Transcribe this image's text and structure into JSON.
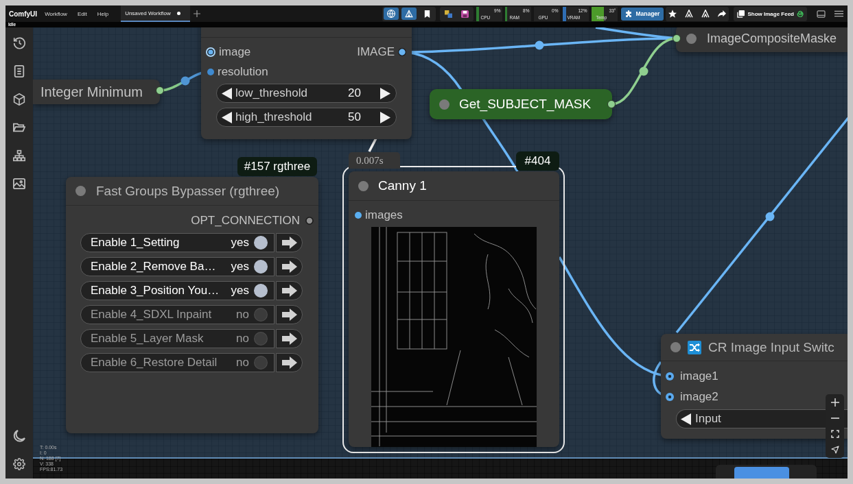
{
  "menu_bar": {
    "app_name": "ComfyUI",
    "menus": [
      "Workflow",
      "Edit",
      "Help"
    ]
  },
  "tabs": [
    {
      "label": "Unsaved Workflow",
      "selected": true,
      "unsaved": true
    }
  ],
  "toolbar": {
    "toggles": [
      {
        "kind": "translate",
        "on": true
      },
      {
        "kind": "shape",
        "on": true
      },
      {
        "kind": "bookmark",
        "on": false
      }
    ],
    "monitors": [
      {
        "label": "CPU",
        "reading": "9%",
        "level": 0.09,
        "color": "#2e7d32"
      },
      {
        "label": "RAM",
        "reading": "8%",
        "level": 0.08,
        "color": "#2e7d32"
      },
      {
        "label": "GPU",
        "reading": "0%"
      },
      {
        "label": "VRAM",
        "reading": "12%",
        "level": 0.12,
        "color": "#2f6db3"
      },
      {
        "label": "Temp",
        "reading": "33°",
        "level": 0.45,
        "color": "#4c9a2a"
      }
    ],
    "manager_button": {
      "label": "Manager"
    },
    "image_feed_button": {
      "label": "Show Image Feed"
    }
  },
  "status": {
    "label": "Idle"
  },
  "canvas": {
    "edge_node": {
      "inputs": [
        {
          "label": "image",
          "highlighted": true
        },
        {
          "label": "resolution",
          "highlighted": false
        }
      ],
      "outputs": [
        {
          "label": "IMAGE"
        }
      ],
      "widgets": [
        {
          "label": "low_threshold",
          "value": "20"
        },
        {
          "label": "high_threshold",
          "value": "50"
        }
      ]
    },
    "collapsed_nodes": [
      {
        "title": "Integer Minimum",
        "color": "#353535"
      },
      {
        "title": "Get_SUBJECT_MASK",
        "color": "#2b6426"
      },
      {
        "title": "ImageCompositeMaske",
        "color": "#353535"
      }
    ],
    "bypasser_node": {
      "badge": "#157 rgthree",
      "title": "Fast Groups Bypasser (rgthree)",
      "output": "OPT_CONNECTION",
      "groups": [
        {
          "label": "Enable 1_Setting",
          "value": "yes",
          "on": true
        },
        {
          "label": "Enable 2_Remove Ba…",
          "value": "yes",
          "on": true
        },
        {
          "label": "Enable 3_Position You…",
          "value": "yes",
          "on": true
        },
        {
          "label": "Enable 4_SDXL Inpaint",
          "value": "no",
          "on": false
        },
        {
          "label": "Enable 5_Layer Mask",
          "value": "no",
          "on": false
        },
        {
          "label": "Enable 6_Restore Detail",
          "value": "no",
          "on": false
        }
      ]
    },
    "canny_node": {
      "timing": "0.007s",
      "badge": "#404",
      "title": "Canny 1",
      "selected": true,
      "inputs": [
        {
          "label": "images"
        }
      ]
    },
    "switch_node": {
      "title": "CR Image Input Switc",
      "inputs": [
        {
          "label": "image1"
        },
        {
          "label": "image2"
        }
      ],
      "widget": {
        "label": "Input"
      }
    },
    "stats": [
      "T: 0.00s",
      "I: 0",
      "N: 188 [7]",
      "V: 338",
      "FPS:81.73"
    ]
  }
}
